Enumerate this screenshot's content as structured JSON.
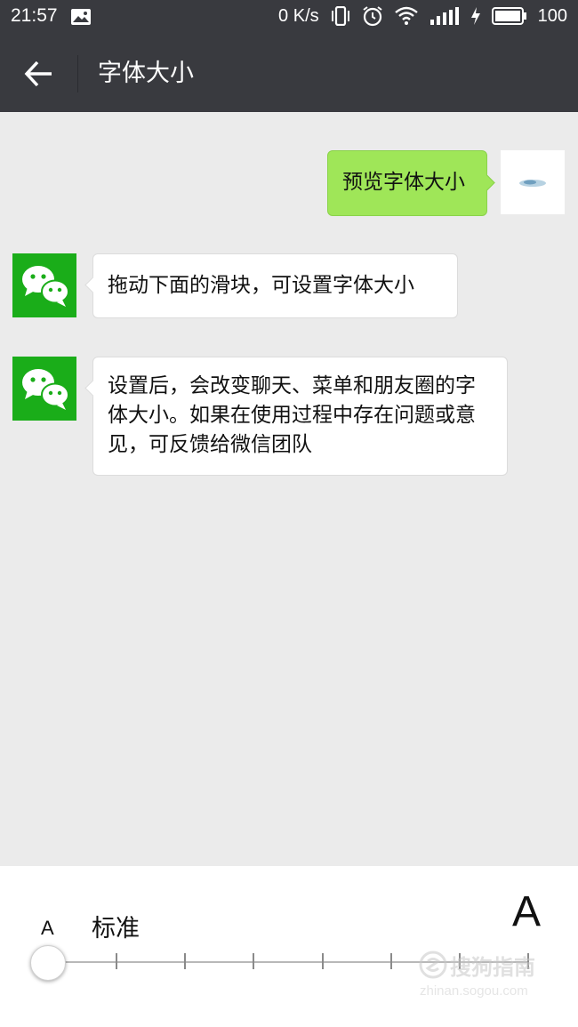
{
  "status_bar": {
    "time": "21:57",
    "net_speed": "0 K/s",
    "battery": "100"
  },
  "header": {
    "title": "字体大小"
  },
  "messages": [
    {
      "sender": "me",
      "text": "预览字体大小"
    },
    {
      "sender": "wechat",
      "text": "拖动下面的滑块，可设置字体大小"
    },
    {
      "sender": "wechat",
      "text": "设置后，会改变聊天、菜单和朋友圈的字体大小。如果在使用过程中存在问题或意见，可反馈给微信团队"
    }
  ],
  "font_size_control": {
    "small_label": "A",
    "current_label": "标准",
    "large_label": "A",
    "steps": 8,
    "selected_step": 1
  },
  "watermark": {
    "text": "搜狗指南",
    "url": "zhinan.sogou.com"
  },
  "colors": {
    "header_bg": "#393a3f",
    "my_bubble": "#9fe658",
    "wechat_green": "#1aad19",
    "chat_bg": "#ebebeb"
  }
}
